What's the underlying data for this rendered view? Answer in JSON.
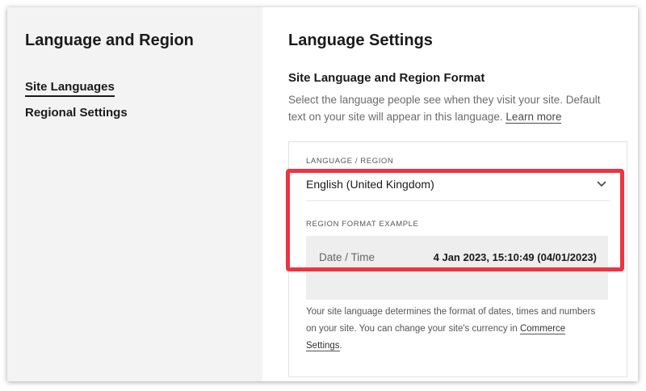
{
  "sidebar": {
    "title": "Language and Region",
    "items": [
      {
        "label": "Site Languages"
      },
      {
        "label": "Regional Settings"
      }
    ]
  },
  "main": {
    "title": "Language Settings",
    "section_title": "Site Language and Region Format",
    "description": "Select the language people see when they visit your site. Default text on your site will appear in this language.",
    "learn_more": "Learn more",
    "language_label": "LANGUAGE / REGION",
    "language_value": "English (United Kingdom)",
    "region_label": "REGION FORMAT EXAMPLE",
    "example": {
      "key": "Date / Time",
      "value": "4 Jan 2023, 15:10:49 (04/01/2023)"
    },
    "note": "Your site language determines the format of dates, times and numbers on your site. You can change your site's currency in",
    "note_link": "Commerce Settings",
    "note_end": "."
  },
  "icons": {
    "dropdown": "chevron-down-icon"
  },
  "colors": {
    "highlight": "#ee3440",
    "sidebar_bg": "#f3f3f3",
    "example_bg": "#eeeeee"
  }
}
